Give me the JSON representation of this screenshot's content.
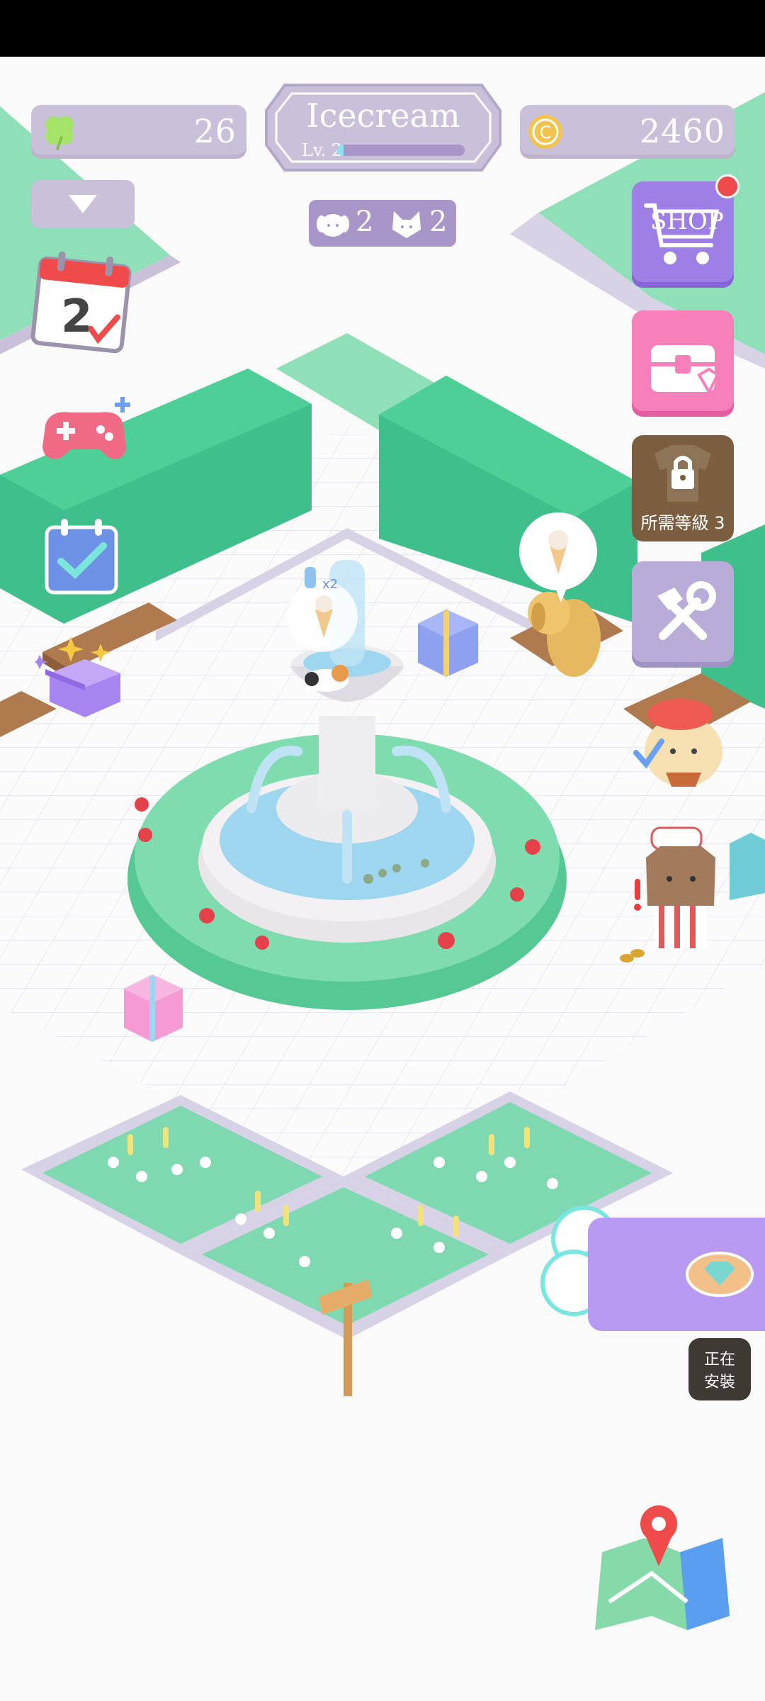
{
  "hud": {
    "clover_count": "26",
    "player_name": "Icecream",
    "level_label": "Lv. 2",
    "level_progress": 0.05,
    "coin_count": "2460",
    "dog_count": "2",
    "cat_count": "2"
  },
  "sidebar": {
    "calendar_day": "2",
    "shop_label": "SHOP",
    "locked_label": "所需等級 3"
  },
  "fountain": {
    "bubble_multiplier": "x2"
  },
  "install_status": {
    "line1": "正在",
    "line2": "安裝"
  },
  "colors": {
    "hud_bg": "#c9c0d9",
    "shop_purple": "#9e7fe6",
    "chest_pink": "#f77fba",
    "locked_brown": "#7a5e3f",
    "tools_purple": "#b9acd8",
    "grass_green": "#5dd3a3",
    "hedge_green": "#3fbf8b"
  },
  "icons": {
    "clover": "clover-icon",
    "coin": "coin-icon",
    "dog": "dog-icon",
    "cat": "cat-icon",
    "dropdown": "chevron-down-icon",
    "calendar": "calendar-icon",
    "gamepad": "gamepad-icon",
    "checklist": "checklist-icon",
    "mystery_box": "mystery-box-icon",
    "cart": "shopping-cart-icon",
    "chest": "treasure-chest-icon",
    "lock": "lock-icon",
    "tools": "tools-icon",
    "map": "map-icon",
    "diamond": "diamond-icon"
  }
}
